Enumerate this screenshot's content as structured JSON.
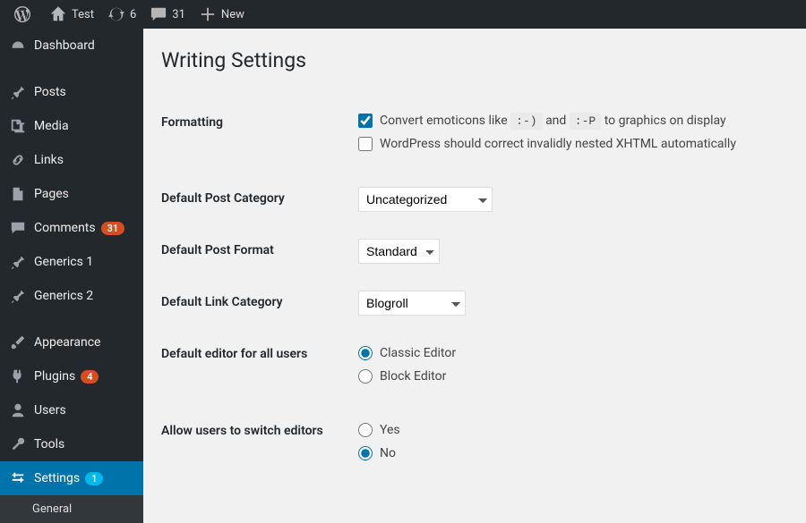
{
  "adminbar": {
    "site_name": "Test",
    "updates_count": "6",
    "comments_count": "31",
    "new_label": "New"
  },
  "sidebar": {
    "items": [
      {
        "label": "Dashboard"
      },
      {
        "label": "Posts"
      },
      {
        "label": "Media"
      },
      {
        "label": "Links"
      },
      {
        "label": "Pages"
      },
      {
        "label": "Comments",
        "badge": "31"
      },
      {
        "label": "Generics 1"
      },
      {
        "label": "Generics 2"
      },
      {
        "label": "Appearance"
      },
      {
        "label": "Plugins",
        "badge": "4"
      },
      {
        "label": "Users"
      },
      {
        "label": "Tools"
      },
      {
        "label": "Settings",
        "badge": "1"
      }
    ],
    "submenu": {
      "general": "General"
    }
  },
  "page": {
    "title": "Writing Settings",
    "rows": {
      "formatting": {
        "label": "Formatting",
        "emoticons_pre": "Convert emoticons like",
        "emoticons_code1": ":-)",
        "emoticons_mid": "and",
        "emoticons_code2": ":-P",
        "emoticons_post": "to graphics on display",
        "xhtml": "WordPress should correct invalidly nested XHTML automatically"
      },
      "default_category": {
        "label": "Default Post Category",
        "value": "Uncategorized"
      },
      "default_format": {
        "label": "Default Post Format",
        "value": "Standard"
      },
      "default_link_category": {
        "label": "Default Link Category",
        "value": "Blogroll"
      },
      "default_editor": {
        "label": "Default editor for all users",
        "option_classic": "Classic Editor",
        "option_block": "Block Editor"
      },
      "allow_switch": {
        "label": "Allow users to switch editors",
        "yes": "Yes",
        "no": "No"
      }
    }
  }
}
